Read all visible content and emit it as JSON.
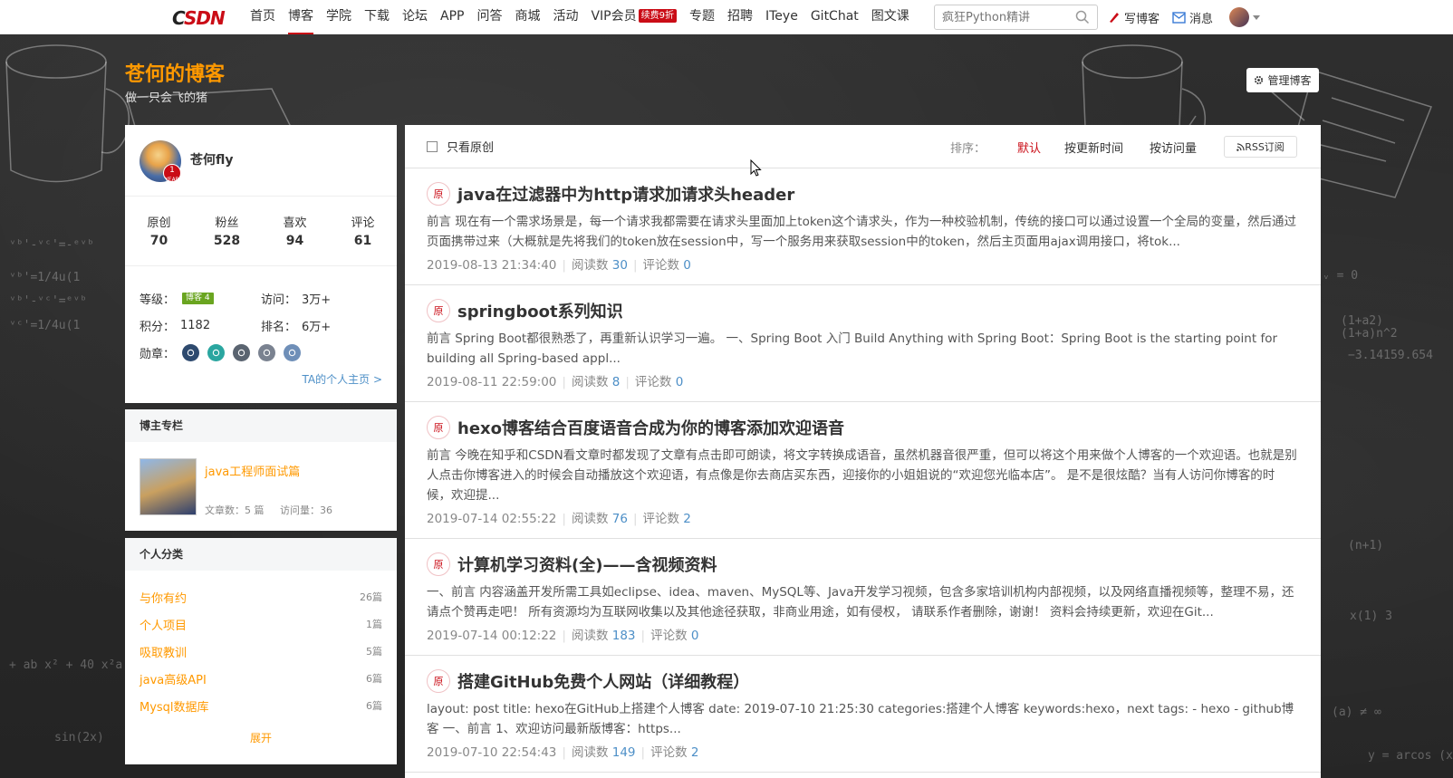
{
  "topnav": {
    "logo": "CSDN",
    "items": [
      "首页",
      "博客",
      "学院",
      "下载",
      "论坛",
      "APP",
      "问答",
      "商城",
      "活动",
      "VIP会员",
      "专题",
      "招聘",
      "ITeye",
      "GitChat",
      "图文课"
    ],
    "active": "博客",
    "vip_badge": "续费9折",
    "search_placeholder": "疯狂Python精讲",
    "write_blog": "写博客",
    "messages": "消息"
  },
  "blog": {
    "title": "苍何的博客",
    "subtitle": "做一只会飞的猪",
    "manage": "管理博客"
  },
  "profile": {
    "name": "苍何fly",
    "year_badge": "1",
    "year_text": "YEAR",
    "stats": [
      {
        "label": "原创",
        "value": "70"
      },
      {
        "label": "粉丝",
        "value": "528"
      },
      {
        "label": "喜欢",
        "value": "94"
      },
      {
        "label": "评论",
        "value": "61"
      }
    ],
    "level_label": "等级：",
    "level_badge": "博客 4",
    "visits_label": "访问：",
    "visits": "3万+",
    "points_label": "积分：",
    "points": "1182",
    "rank_label": "排名：",
    "rank": "6万+",
    "medals_label": "勋章：",
    "medal_colors": [
      "#2e4a6e",
      "#2aa6a0",
      "#5a6470",
      "#7a8290",
      "#6f8fb8"
    ],
    "homepage_link": "TA的个人主页 >"
  },
  "column": {
    "header": "博主专栏",
    "title": "java工程师面试篇",
    "articles": "文章数：5 篇",
    "views": "访问量：36"
  },
  "categories": {
    "header": "个人分类",
    "items": [
      {
        "name": "与你有约",
        "count": "26篇"
      },
      {
        "name": "个人项目",
        "count": "1篇"
      },
      {
        "name": "吸取教训",
        "count": "5篇"
      },
      {
        "name": "java高级API",
        "count": "6篇"
      },
      {
        "name": "Mysql数据库",
        "count": "6篇"
      }
    ],
    "expand": "展开"
  },
  "list": {
    "only_original": "只看原创",
    "sort_label": "排序：",
    "sort_default": "默认",
    "sort_updated": "按更新时间",
    "sort_views": "按访问量",
    "rss": "RSS订阅",
    "read_label": "阅读数",
    "comment_label": "评论数",
    "tag": "原",
    "articles": [
      {
        "title": "java在过滤器中为http请求加请求头header",
        "desc": "前言 现在有一个需求场景是，每一个请求我都需要在请求头里面加上token这个请求头，作为一种校验机制，传统的接口可以通过设置一个全局的变量，然后通过页面携带过来（大概就是先将我们的token放在session中，写一个服务用来获取session中的token，然后主页面用ajax调用接口，将tok...",
        "date": "2019-08-13 21:34:40",
        "reads": "30",
        "comments": "0"
      },
      {
        "title": "springboot系列知识",
        "desc": "前言 Spring Boot都很熟悉了，再重新认识学习一遍。 一、Spring Boot 入门 Build Anything with Spring Boot：Spring Boot is the starting point for building all Spring-based appl...",
        "date": "2019-08-11 22:59:00",
        "reads": "8",
        "comments": "0"
      },
      {
        "title": "hexo博客结合百度语音合成为你的博客添加欢迎语音",
        "desc": "前言 今晚在知乎和CSDN看文章时都发现了文章有点击即可朗读，将文字转换成语音，虽然机器音很严重，但可以将这个用来做个人博客的一个欢迎语。也就是别人点击你博客进入的时候会自动播放这个欢迎语，有点像是你去商店买东西，迎接你的小姐姐说的“欢迎您光临本店”。 是不是很炫酷？当有人访问你博客的时候，欢迎提...",
        "date": "2019-07-14 02:55:22",
        "reads": "76",
        "comments": "2"
      },
      {
        "title": "计算机学习资料(全)——含视频资料",
        "desc": "一、前言 内容涵盖开发所需工具如eclipse、idea、maven、MySQL等、Java开发学习视频，包含多家培训机构内部视频，以及网络直播视频等，整理不易，还请点个赞再走吧！ 所有资源均为互联网收集以及其他途径获取，非商业用途，如有侵权， 请联系作者删除，谢谢！ 资料会持续更新，欢迎在Git...",
        "date": "2019-07-14 00:12:22",
        "reads": "183",
        "comments": "0"
      },
      {
        "title": "搭建GitHub免费个人网站（详细教程）",
        "desc": "layout: post title: hexo在GitHub上搭建个人博客 date: 2019-07-10 21:25:30 categories:搭建个人博客 keywords:hexo，next tags: - hexo - github博客 一、前言 1、欢迎访问最新版博客：https...",
        "date": "2019-07-10 22:54:43",
        "reads": "149",
        "comments": "2"
      }
    ]
  }
}
